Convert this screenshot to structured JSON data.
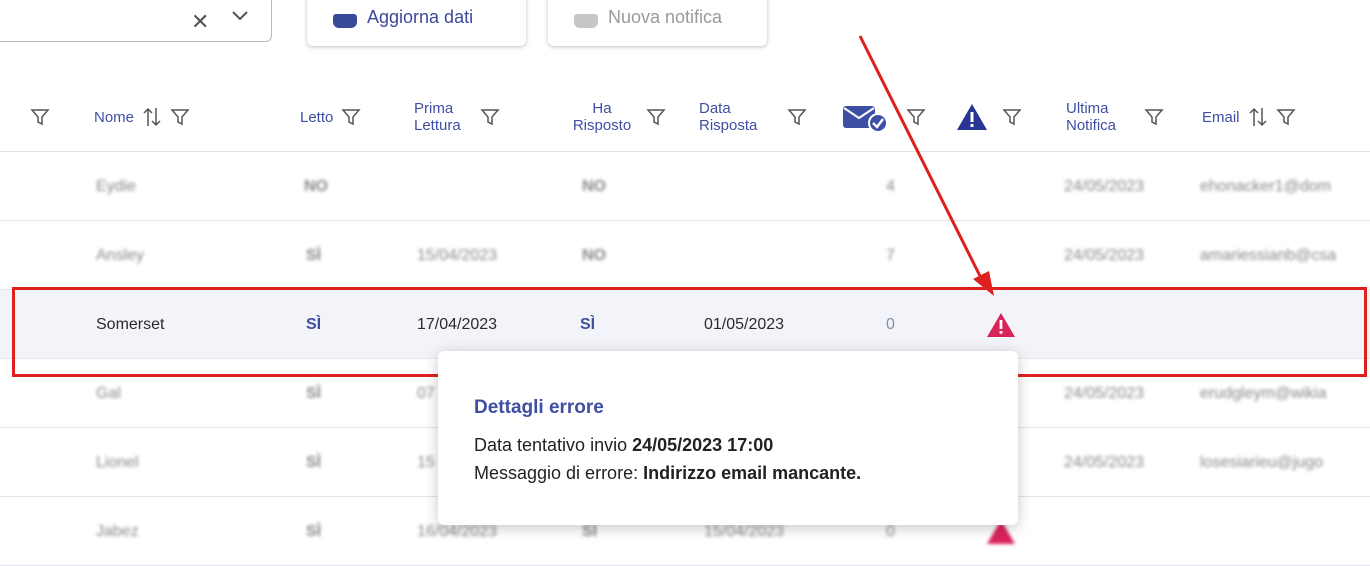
{
  "toolbar": {
    "update_label": "Aggiorna dati",
    "notify_label": "Nuova notifica"
  },
  "header": {
    "nome": "Nome",
    "letto": "Letto",
    "prima_lettura_1": "Prima",
    "prima_lettura_2": "Lettura",
    "ha_risposto_1": "Ha",
    "ha_risposto_2": "Risposto",
    "data_risposta_1": "Data",
    "data_risposta_2": "Risposta",
    "ultima_notifica_1": "Ultima",
    "ultima_notifica_2": "Notifica",
    "email": "Email"
  },
  "rows": [
    {
      "nome": "Eydie",
      "letto": "NO",
      "prima_lettura": "",
      "ha_risposto": "NO",
      "data_risposta": "",
      "count": "4",
      "ultima_notifica": "24/05/2023",
      "email": "ehonacker1@dom"
    },
    {
      "nome": "Ansley",
      "letto": "SÌ",
      "prima_lettura": "15/04/2023",
      "ha_risposto": "NO",
      "data_risposta": "",
      "count": "7",
      "ultima_notifica": "24/05/2023",
      "email": "amariessianb@csa"
    },
    {
      "nome": "Somerset",
      "letto": "SÌ",
      "prima_lettura": "17/04/2023",
      "ha_risposto": "SÌ",
      "data_risposta": "01/05/2023",
      "count": "0",
      "ultima_notifica": "",
      "email": ""
    },
    {
      "nome": "Gal",
      "letto": "SÌ",
      "prima_lettura": "07",
      "ha_risposto": "",
      "data_risposta": "",
      "count": "",
      "ultima_notifica": "24/05/2023",
      "email": "erudgleym@wikia"
    },
    {
      "nome": "Lionel",
      "letto": "SÌ",
      "prima_lettura": "15",
      "ha_risposto": "",
      "data_risposta": "",
      "count": "",
      "ultima_notifica": "24/05/2023",
      "email": "losesiarieu@jugo"
    },
    {
      "nome": "Jabez",
      "letto": "SÌ",
      "prima_lettura": "16/04/2023",
      "ha_risposto": "SÌ",
      "data_risposta": "15/04/2023",
      "count": "0",
      "ultima_notifica": "",
      "email": ""
    }
  ],
  "tooltip": {
    "title": "Dettagli errore",
    "line1_label": "Data tentativo invio ",
    "line1_value": "24/05/2023 17:00",
    "line2_label": "Messaggio di errore: ",
    "line2_value": "Indirizzo email mancante."
  },
  "colors": {
    "accent": "#3e4fa3",
    "no": "#e0507a",
    "warning": "#d9245a",
    "highlight": "#e0201f"
  },
  "icons": [
    "filter-icon",
    "sort-icon",
    "mail-check-icon",
    "warning-icon",
    "close-icon",
    "chevron-down-icon",
    "download-icon",
    "mail-icon"
  ]
}
